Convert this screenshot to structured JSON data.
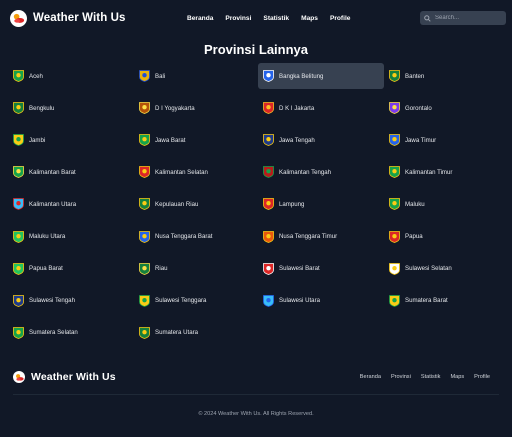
{
  "app": {
    "name": "Weather With Us"
  },
  "nav": [
    {
      "label": "Beranda"
    },
    {
      "label": "Provinsi"
    },
    {
      "label": "Statistik"
    },
    {
      "label": "Maps"
    },
    {
      "label": "Profile"
    }
  ],
  "search": {
    "placeholder": "Search..."
  },
  "main": {
    "title": "Provinsi Lainnya"
  },
  "provinces": [
    {
      "name": "Aceh",
      "color": "#16a34a",
      "accent": "#facc15"
    },
    {
      "name": "Bali",
      "color": "#eab308",
      "accent": "#1d4ed8"
    },
    {
      "name": "Bangka Belitung",
      "color": "#2563eb",
      "accent": "#ffffff",
      "active": true
    },
    {
      "name": "Banten",
      "color": "#15803d",
      "accent": "#facc15"
    },
    {
      "name": "Bengkulu",
      "color": "#15803d",
      "accent": "#facc15"
    },
    {
      "name": "D I Yogyakarta",
      "color": "#b45309",
      "accent": "#fde047"
    },
    {
      "name": "D K I Jakarta",
      "color": "#dc2626",
      "accent": "#fbbf24"
    },
    {
      "name": "Gorontalo",
      "color": "#7c3aed",
      "accent": "#fde047"
    },
    {
      "name": "Jambi",
      "color": "#facc15",
      "accent": "#16a34a"
    },
    {
      "name": "Jawa Barat",
      "color": "#16a34a",
      "accent": "#facc15"
    },
    {
      "name": "Jawa Tengah",
      "color": "#1e3a8a",
      "accent": "#facc15"
    },
    {
      "name": "Jawa Timur",
      "color": "#2563eb",
      "accent": "#facc15"
    },
    {
      "name": "Kalimantan Barat",
      "color": "#16a34a",
      "accent": "#fde047"
    },
    {
      "name": "Kalimantan Selatan",
      "color": "#dc2626",
      "accent": "#facc15"
    },
    {
      "name": "Kalimantan Tengah",
      "color": "#b91c1c",
      "accent": "#16a34a"
    },
    {
      "name": "Kalimantan Timur",
      "color": "#16a34a",
      "accent": "#facc15"
    },
    {
      "name": "Kalimantan Utara",
      "color": "#38bdf8",
      "accent": "#dc2626"
    },
    {
      "name": "Kepulauan Riau",
      "color": "#15803d",
      "accent": "#facc15"
    },
    {
      "name": "Lampung",
      "color": "#dc2626",
      "accent": "#facc15"
    },
    {
      "name": "Maluku",
      "color": "#16a34a",
      "accent": "#facc15"
    },
    {
      "name": "Maluku Utara",
      "color": "#22c55e",
      "accent": "#facc15"
    },
    {
      "name": "Nusa Tenggara Barat",
      "color": "#2563eb",
      "accent": "#facc15"
    },
    {
      "name": "Nusa Tenggara Timur",
      "color": "#ea580c",
      "accent": "#facc15"
    },
    {
      "name": "Papua",
      "color": "#dc2626",
      "accent": "#facc15"
    },
    {
      "name": "Papua Barat",
      "color": "#22c55e",
      "accent": "#facc15"
    },
    {
      "name": "Riau",
      "color": "#15803d",
      "accent": "#fde047"
    },
    {
      "name": "Sulawesi Barat",
      "color": "#dc2626",
      "accent": "#ffffff"
    },
    {
      "name": "Sulawesi Selatan",
      "color": "#ffffff",
      "accent": "#facc15"
    },
    {
      "name": "Sulawesi Tengah",
      "color": "#1e3a8a",
      "accent": "#facc15"
    },
    {
      "name": "Sulawesi Tenggara",
      "color": "#facc15",
      "accent": "#16a34a"
    },
    {
      "name": "Sulawesi Utara",
      "color": "#38bdf8",
      "accent": "#2563eb"
    },
    {
      "name": "Sumatera Barat",
      "color": "#facc15",
      "accent": "#16a34a"
    },
    {
      "name": "Sumatera Selatan",
      "color": "#16a34a",
      "accent": "#facc15"
    },
    {
      "name": "Sumatera Utara",
      "color": "#15803d",
      "accent": "#facc15"
    }
  ],
  "footer": {
    "brand": "Weather With Us",
    "links": [
      {
        "label": "Beranda"
      },
      {
        "label": "Provinsi"
      },
      {
        "label": "Statistik"
      },
      {
        "label": "Maps"
      },
      {
        "label": "Profile"
      }
    ],
    "copyright": "© 2024 Weather With Us. All Rights Reserved."
  }
}
